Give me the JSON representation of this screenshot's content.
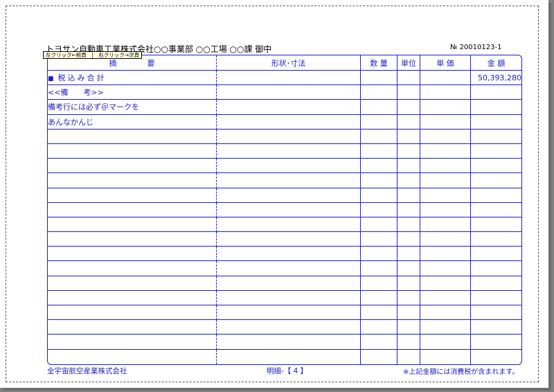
{
  "header": {
    "addressee": "トヨサン自動車工業株式会社○○事業部 ○○工場 ○○課 御中",
    "doc_number": "№ 20010123-1",
    "tooltip": "左クリック←前頁　|　右クリック→次頁"
  },
  "table": {
    "columns": {
      "description": "摘　　　　要",
      "spec": "形状･寸法",
      "quantity": "数 量",
      "unit": "単位",
      "unit_price": "単 価",
      "amount": "金 額"
    },
    "total_row": {
      "bullet": "■",
      "label": "税込み合計",
      "amount": "50,393,280"
    },
    "notes": [
      "<<備　　考>>",
      "備考行には必ず＠マークを",
      "あんなかんじ"
    ],
    "blank_row_count": 16
  },
  "footer": {
    "company": "全宇宙航空産業株式会社",
    "page": "明細-【 4 】",
    "note": "※上記金額には消費税が含まれます。"
  },
  "colors": {
    "rule": "#1e1ec8",
    "tooltip_bg": "#ffffe1"
  }
}
